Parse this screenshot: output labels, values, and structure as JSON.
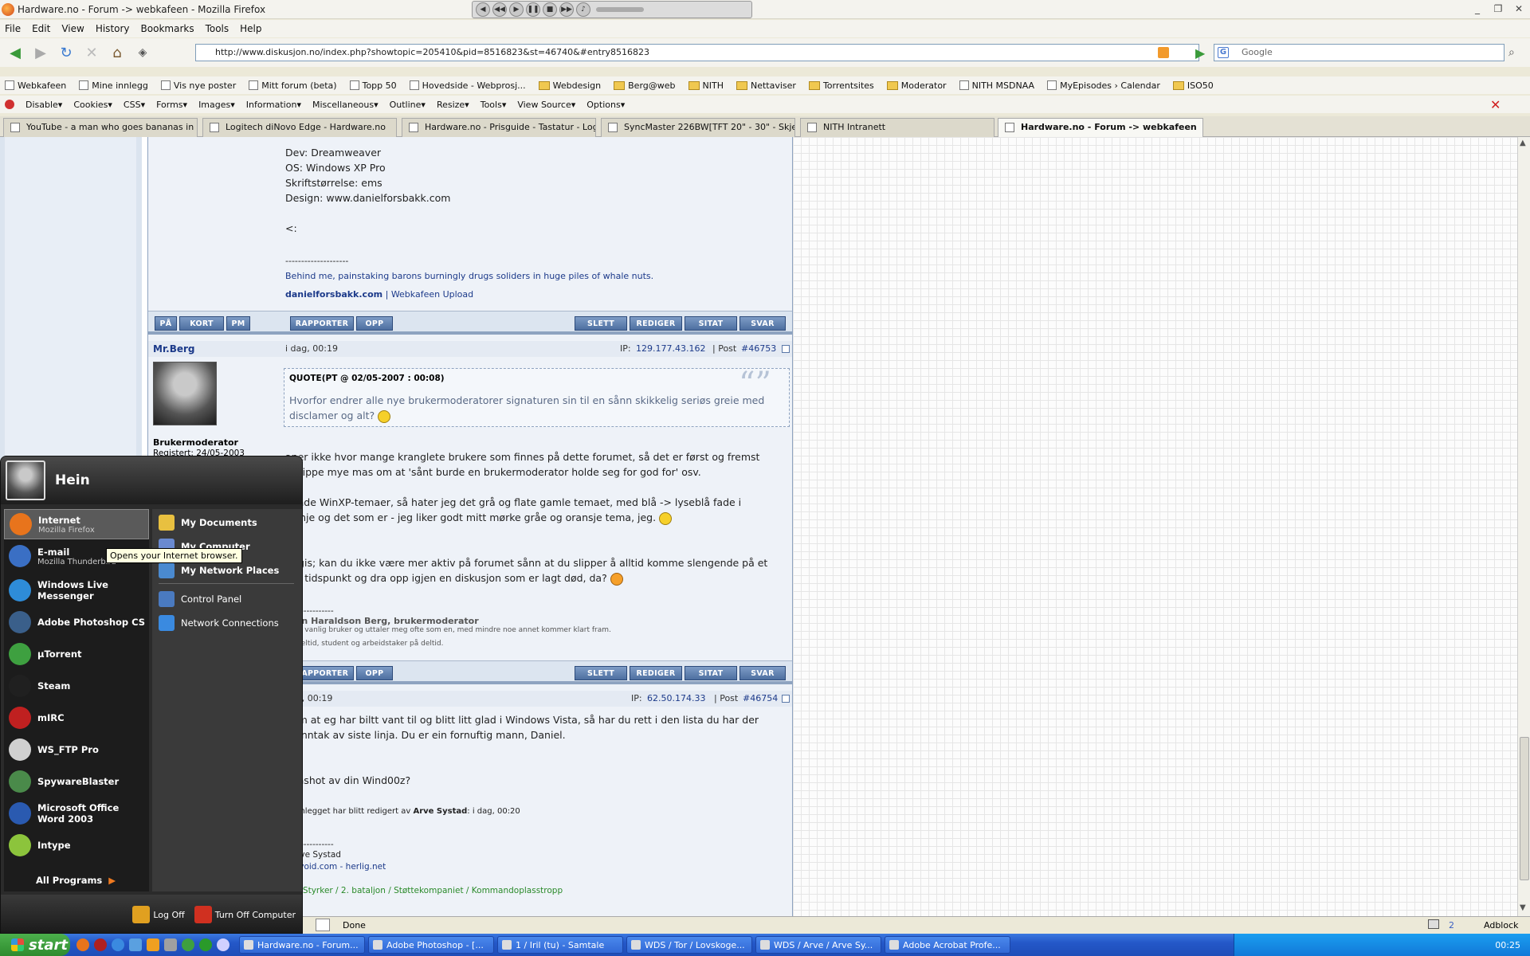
{
  "window": {
    "title": "Hardware.no - Forum -> webkafeen - Mozilla Firefox"
  },
  "menu": [
    "File",
    "Edit",
    "View",
    "History",
    "Bookmarks",
    "Tools",
    "Help"
  ],
  "nav": {
    "url": "http://www.diskusjon.no/index.php?showtopic=205410&pid=8516823&st=46740&#entry8516823",
    "search_placeholder": "Google"
  },
  "bookmarks": [
    {
      "label": "Webkafeen",
      "kind": "page"
    },
    {
      "label": "Mine innlegg",
      "kind": "page"
    },
    {
      "label": "Vis nye poster",
      "kind": "page"
    },
    {
      "label": "Mitt forum (beta)",
      "kind": "page"
    },
    {
      "label": "Topp 50",
      "kind": "page"
    },
    {
      "label": "Hovedside - Webprosj...",
      "kind": "page"
    },
    {
      "label": "Webdesign",
      "kind": "folder"
    },
    {
      "label": "Berg@web",
      "kind": "folder"
    },
    {
      "label": "NITH",
      "kind": "folder"
    },
    {
      "label": "Nettaviser",
      "kind": "folder"
    },
    {
      "label": "Torrentsites",
      "kind": "folder"
    },
    {
      "label": "Moderator",
      "kind": "folder"
    },
    {
      "label": "NITH MSDNAA",
      "kind": "page"
    },
    {
      "label": "MyEpisodes › Calendar",
      "kind": "page"
    },
    {
      "label": "ISO50",
      "kind": "folder"
    }
  ],
  "devbar": [
    "Disable▾",
    "Cookies▾",
    "CSS▾",
    "Forms▾",
    "Images▾",
    "Information▾",
    "Miscellaneous▾",
    "Outline▾",
    "Resize▾",
    "Tools▾",
    "View Source▾",
    "Options▾"
  ],
  "tabs": [
    "YouTube - a man who goes bananas in or...",
    "Logitech diNovo Edge - Hardware.no",
    "Hardware.no - Prisguide - Tastatur - Logite...",
    "SyncMaster 226BW[TFT 20\" - 30\" - Skjer...",
    "NITH Intranett",
    "Hardware.no - Forum -> webkafeen"
  ],
  "post1": {
    "lines": [
      "Dev: Dreamweaver",
      "OS: Windows XP Pro",
      "Skriftstørrelse: ems",
      "Design: www.danielforsbakk.com",
      "<:"
    ],
    "divider": "--------------------",
    "sig": "Behind me, painstaking barons burningly drugs soliders in huge piles of whale nuts.",
    "sig_link1": "danielforsbakk.com",
    "sig_sep": "|",
    "sig_link2": "Webkafeen Upload"
  },
  "buttons": {
    "pa": "PÅ",
    "kort": "KORT",
    "pm": "PM",
    "rapporter": "RAPPORTER",
    "opp": "OPP",
    "slett": "SLETT",
    "rediger": "REDIGER",
    "sitat": "SITAT",
    "svar": "SVAR"
  },
  "post2": {
    "author": "Mr.Berg",
    "date": "i dag, 00:19",
    "ip_label": "IP:",
    "ip": "129.177.43.162",
    "post_label": "| Post",
    "post_no": "#46753",
    "role": "Brukermoderator",
    "registered": "Registert: 24/05-2003",
    "quote_head": "QUOTE(PT @ 02/05-2007 : 00:08)",
    "quote_text": "Hvorfor endrer alle nye brukermoderatorer signaturen sin til en sånn skikkelig seriøs greie med disclamer og alt?",
    "p1": "aner ikke hvor mange kranglete brukere som finnes på dette forumet, så det er først og fremst",
    "p1b": "å slippe mye mas om at 'sånt burde en brukermoderator holde seg for god for' osv.",
    "p2": "ående WinXP-temaer, så hater jeg det grå og flate gamle temaet, med blå -> lyseblå fade i",
    "p2b": "ellinje og det som er - jeg liker godt mitt mørke gråe og oransje tema, jeg.",
    "p3": "jorgis; kan du ikke være mer aktiv på forumet sånn at du slipper å alltid komme slengende på et",
    "p3b": "ere tidspunkt og dra opp igjen en diskusjon som er lagt død, da?",
    "sigdiv": "----------------",
    "sig1": "Hein Haraldson Berg, brukermoderator",
    "sig2": "også vanlig bruker og uttaler meg ofte som en, med mindre noe annet kommer klart fram.",
    "sig3": "på heltid, student og arbeidstaker på deltid."
  },
  "post3": {
    "date": "dag, 00:19",
    "ip_label": "IP:",
    "ip": "62.50.174.33",
    "post_label": "| Post",
    "post_no": "#46754",
    "l1": "nom at eg har biltt vant til og blitt litt glad i Windows Vista, så har du rett i den lista du har der",
    "l2": "d unntak av siste linja. Du er ein fornuftig mann, Daniel.",
    "l3": "n:",
    "l4": "eenshot av din Wind00z?",
    "edit": "e innlegget har blitt redigert av",
    "edit_by": "Arve Systad",
    "edit_when": ": i dag, 00:20",
    "div": "----------------",
    "s1": ": Arve Systad",
    "s2": "entvoid.com - herlig.net",
    "s3": "fm",
    "s4": "ens Styrker / 2. bataljon / Støttekompaniet / Kommandoplasstropp"
  },
  "status": {
    "text": "Done",
    "mail_count": "2",
    "adblock": "Adblock"
  },
  "startmenu": {
    "user": "Hein",
    "pinned": [
      {
        "label": "Internet",
        "sub": "Mozilla Firefox",
        "color": "#e8741c"
      },
      {
        "label": "E-mail",
        "sub": "Mozilla Thunderbird",
        "color": "#3a6fc4"
      }
    ],
    "recent": [
      {
        "label": "Windows Live Messenger",
        "color": "#2e8cd8"
      },
      {
        "label": "Adobe Photoshop CS",
        "color": "#3a5f8a"
      },
      {
        "label": "µTorrent",
        "color": "#3ea040"
      },
      {
        "label": "Steam",
        "color": "#202020"
      },
      {
        "label": "mIRC",
        "color": "#c02020"
      },
      {
        "label": "WS_FTP Pro",
        "color": "#d0d0d0"
      },
      {
        "label": "SpywareBlaster",
        "color": "#4a8a4a"
      },
      {
        "label": "Microsoft Office Word 2003",
        "color": "#2a5ab0"
      },
      {
        "label": "Intype",
        "color": "#8cc43c"
      }
    ],
    "all_programs": "All Programs",
    "right": [
      "My Documents",
      "My Computer",
      "My Network Places",
      "Control Panel",
      "Network Connections"
    ],
    "logoff": "Log Off",
    "turnoff": "Turn Off Computer",
    "tooltip": "Opens your Internet browser."
  },
  "taskbar": {
    "start": "start",
    "items": [
      "Hardware.no - Forum...",
      "Adobe Photoshop - [...",
      "1 / Iril (tu) - Samtale",
      "WDS / Tor / Lovskoge...",
      "WDS / Arve / Arve Sy...",
      "Adobe Acrobat Profe..."
    ],
    "clock": "00:25"
  }
}
